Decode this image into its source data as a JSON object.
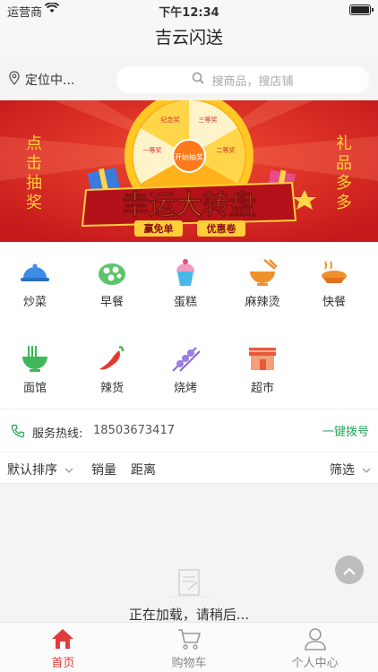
{
  "status": {
    "carrier": "运营商",
    "time": "下午12:34"
  },
  "nav": {
    "title": "吉云闪送"
  },
  "location": {
    "label": "定位中..."
  },
  "search": {
    "placeholder": "搜商品，搜店铺"
  },
  "banner": {
    "title": "幸运大转盘",
    "left_text": [
      "点",
      "击",
      "抽",
      "奖"
    ],
    "right_text": [
      "礼",
      "品",
      "多",
      "多"
    ],
    "tag_left": "赢免单",
    "tag_right": "优惠卷",
    "wheel_labels": [
      "纪念奖",
      "三等奖",
      "二等奖",
      "一等奖"
    ],
    "wheel_center": "开始抽奖"
  },
  "categories": [
    {
      "label": "炒菜",
      "icon": "dish-cover-icon"
    },
    {
      "label": "早餐",
      "icon": "breakfast-icon"
    },
    {
      "label": "蛋糕",
      "icon": "cake-icon"
    },
    {
      "label": "麻辣烫",
      "icon": "hotpot-bowl-icon"
    },
    {
      "label": "快餐",
      "icon": "fast-food-icon"
    },
    {
      "label": "面馆",
      "icon": "noodle-bowl-icon"
    },
    {
      "label": "辣货",
      "icon": "chili-icon"
    },
    {
      "label": "烧烤",
      "icon": "skewer-icon"
    },
    {
      "label": "超市",
      "icon": "store-icon"
    }
  ],
  "hotline": {
    "title": "服务热线:",
    "number": "18503673417",
    "dial": "一键拨号"
  },
  "sort": {
    "default": "默认排序",
    "sales": "销量",
    "distance": "距离",
    "filter": "筛选"
  },
  "loading": {
    "text": "正在加载，请稍后..."
  },
  "tabs": [
    {
      "label": "首页",
      "active": true
    },
    {
      "label": "购物车",
      "active": false
    },
    {
      "label": "个人中心",
      "active": false
    }
  ],
  "colors": {
    "accent_red": "#e23b3b",
    "green": "#26a65b",
    "banner_red": "#d8231d",
    "banner_yellow": "#ffc825"
  }
}
